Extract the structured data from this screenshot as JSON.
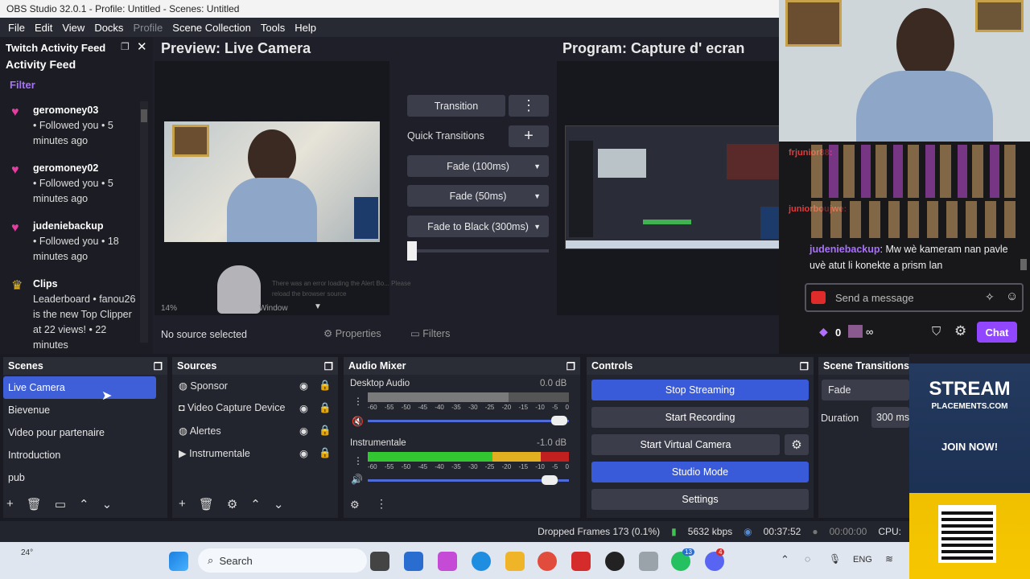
{
  "window": {
    "title": "OBS Studio 32.0.1 - Profile: Untitled - Scenes: Untitled"
  },
  "menu": [
    "File",
    "Edit",
    "View",
    "Docks",
    "Profile",
    "Scene Collection",
    "Tools",
    "Help"
  ],
  "twitch_dock": {
    "title": "Twitch Activity Feed",
    "subtitle": "Activity Feed",
    "filter": "Filter",
    "items": [
      {
        "user": "geromoney03",
        "text": "• Followed you • 5 minutes ago"
      },
      {
        "user": "geromoney02",
        "text": "• Followed you • 5 minutes ago"
      },
      {
        "user": "judeniebackup",
        "text": "• Followed you • 18 minutes ago"
      },
      {
        "user": "Clips",
        "text": "Leaderboard • fanou26 is the new Top Clipper at 22 views! • 22 minutes"
      }
    ]
  },
  "preview": {
    "title": "Preview: Live Camera",
    "zoom": "14%",
    "window_label": "Window",
    "error": "There was an error loading the Alert Bo... Please reload the browser source"
  },
  "program": {
    "title": "Program: Capture d' ecran"
  },
  "transitions": {
    "transition_label": "Transition",
    "quick_label": "Quick Transitions",
    "options": [
      "Fade (100ms)",
      "Fade (50ms)",
      "Fade to Black (300ms)"
    ]
  },
  "source_bar": {
    "no_source": "No source selected",
    "properties": "Properties",
    "filters": "Filters"
  },
  "scenes": {
    "title": "Scenes",
    "items": [
      "Live Camera",
      "Bievenue",
      "Video pour partenaire",
      "Introduction",
      "pub"
    ]
  },
  "sources": {
    "title": "Sources",
    "items": [
      "Sponsor",
      "Video Capture Device",
      "Alertes",
      "Instrumentale"
    ]
  },
  "audio": {
    "title": "Audio Mixer",
    "channels": [
      {
        "name": "Desktop Audio",
        "db": "0.0 dB"
      },
      {
        "name": "Instrumentale",
        "db": "-1.0 dB"
      }
    ],
    "scale": [
      "-60",
      "-55",
      "-50",
      "-45",
      "-40",
      "-35",
      "-30",
      "-25",
      "-20",
      "-15",
      "-10",
      "-5",
      "0"
    ]
  },
  "controls": {
    "title": "Controls",
    "buttons": [
      "Stop Streaming",
      "Start Recording",
      "Start Virtual Camera",
      "Studio Mode",
      "Settings"
    ]
  },
  "scene_transitions": {
    "title": "Scene Transitions",
    "value": "Fade",
    "duration_label": "Duration",
    "duration_value": "300 ms"
  },
  "status": {
    "dropped": "Dropped Frames 173 (0.1%)",
    "kbps": "5632 kbps",
    "live_time": "00:37:52",
    "rec_time": "00:00:00",
    "cpu": "CPU:"
  },
  "chat": {
    "lines": [
      {
        "user": "frjunior88:",
        "text": ""
      },
      {
        "user": "juniorboujwe:",
        "text": ""
      },
      {
        "user": "judeniebackup",
        "text": ": Mw wè kameram nan pavle uvè atut li konekte a prism lan"
      }
    ],
    "placeholder": "Send a message",
    "points": "0",
    "infinity": "∞",
    "chat_button": "Chat",
    "accent": "#9147ff"
  },
  "ad": {
    "brand": "STREAM",
    "domain": "PLACEMENTS.COM",
    "cta": "JOIN NOW!"
  },
  "taskbar": {
    "weather": "24°",
    "search": "Search",
    "lang": "ENG",
    "badge1": "13",
    "badge2": "4"
  }
}
